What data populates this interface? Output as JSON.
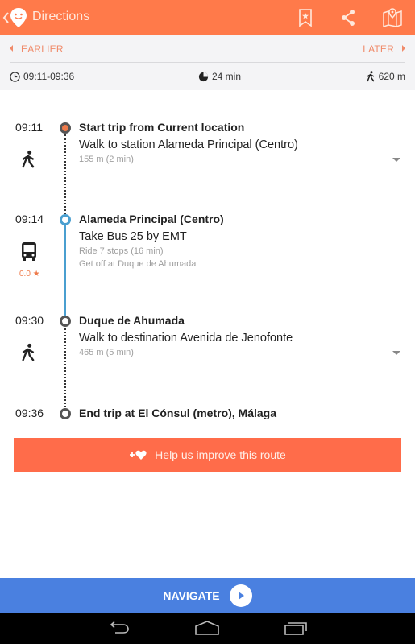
{
  "appbar": {
    "title": "Directions",
    "icons": [
      "back-icon",
      "app-logo-icon",
      "bookmark-star-icon",
      "share-icon",
      "map-pin-icon"
    ],
    "accent": "#ff7a4a"
  },
  "time_nav": {
    "earlier_label": "EARLIER",
    "later_label": "LATER"
  },
  "summary": {
    "time_range": "09:11-09:36",
    "duration": "24 min",
    "walk_distance": "620 m"
  },
  "steps": [
    {
      "time": "09:11",
      "title": "Start trip from Current location",
      "instruction": "Walk to station Alameda Principal (Centro)",
      "detail": "155 m (2  min)",
      "mode": "walk"
    },
    {
      "time": "09:14",
      "title": "Alameda Principal (Centro)",
      "instruction": "Take Bus 25 by EMT",
      "detail": "Ride 7 stops (16  min)",
      "detail2": "Get off at Duque de Ahumada",
      "mode": "bus",
      "rating": "0.0 ★"
    },
    {
      "time": "09:30",
      "title": "Duque de Ahumada",
      "instruction": "Walk to destination Avenida de Jenofonte",
      "detail": "465 m (5  min)",
      "mode": "walk"
    },
    {
      "time": "09:36",
      "title": "End trip at El Cónsul (metro), Málaga"
    }
  ],
  "improve_button": {
    "label": "Help us improve this route",
    "color": "#ff6c4a"
  },
  "navigate_button": {
    "label": "NAVIGATE",
    "color": "#4a80e0"
  },
  "colors": {
    "bus_line": "#4a9fd0",
    "nav_text": "#f08b6b"
  }
}
